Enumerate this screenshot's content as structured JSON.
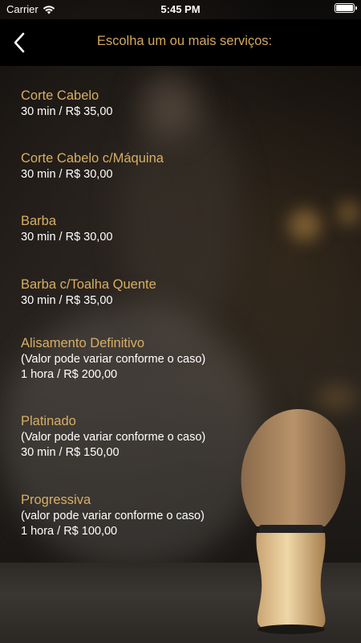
{
  "status_bar": {
    "carrier": "Carrier",
    "time": "5:45 PM"
  },
  "header": {
    "title": "Escolha um ou mais serviços:",
    "back_icon": "chevron-left-icon"
  },
  "colors": {
    "accent": "#d8ae64",
    "text": "#ffffff",
    "nav_background": "#000000"
  },
  "services": [
    {
      "name": "Corte Cabelo",
      "note": "",
      "price": "30 min / R$ 35,00"
    },
    {
      "name": "Corte Cabelo c/Máquina",
      "note": "",
      "price": "30 min / R$ 30,00"
    },
    {
      "name": "Barba",
      "note": "",
      "price": "30 min / R$ 30,00"
    },
    {
      "name": "Barba c/Toalha Quente",
      "note": "",
      "price": "30 min / R$ 35,00"
    },
    {
      "name": "Alisamento Definitivo",
      "note": "(Valor pode variar conforme o caso)",
      "price": "1 hora / R$ 200,00"
    },
    {
      "name": "Platinado",
      "note": "(Valor pode variar conforme o caso)",
      "price": "30 min / R$ 150,00"
    },
    {
      "name": "Progressiva",
      "note": "(valor pode variar conforme o caso)",
      "price": "1 hora / R$ 100,00"
    }
  ]
}
